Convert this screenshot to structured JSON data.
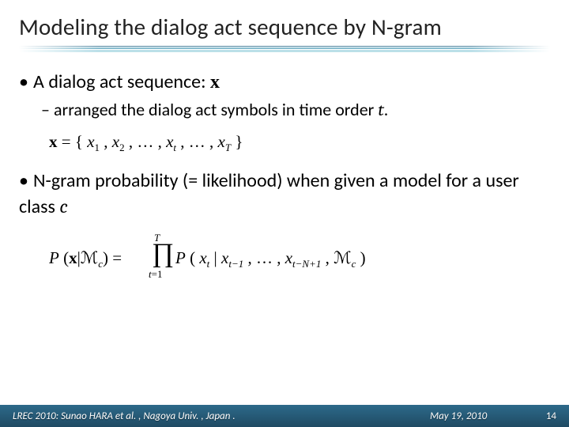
{
  "title": "Modeling the dialog act sequence by N-gram",
  "bullet1_prefix": "A dialog act sequence:  ",
  "bullet1_var": "x",
  "sub1_prefix": "arranged the dialog act symbols in time order ",
  "sub1_var": "t",
  "sub1_suffix": ".",
  "eq1_tex": "\\mathbf{x} = \\{x_1, x_2, \\ldots, x_t, \\ldots, x_T\\}",
  "bullet2_prefix": "N-gram probability (= likelihood) when given a model for a user class ",
  "bullet2_var": "c",
  "eq2_tex": "P(\\mathbf{x}\\mid\\mathcal{M}_c) = \\prod_{t=1}^{T} P(x_t \\mid x_{t-1},\\ldots,x_{t-N+1},\\mathcal{M}_c)",
  "footer": {
    "venue": "LREC 2010: Sunao HARA et al. , Nagoya Univ. , Japan .",
    "date": "May 19, 2010",
    "page": "14"
  }
}
